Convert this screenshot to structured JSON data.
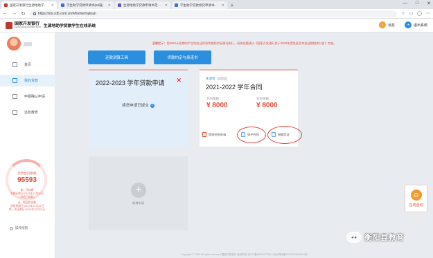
{
  "browser": {
    "tabs": [
      {
        "label": "国家开发银行生源地助学贷款学…",
        "icon": "red-square-icon",
        "active": true
      },
      {
        "label": "学生助学贷款申请书(50篇)",
        "icon": "blue-page-icon",
        "active": false
      },
      {
        "label": "生源地助学贷款申请书范文150字 -",
        "icon": "purple-page-icon",
        "active": false
      },
      {
        "label": "学生助学贷款续贷申请书（通用15",
        "icon": "blue-page-icon",
        "active": false
      }
    ],
    "new_tab": "+",
    "url": "https://sls.cdb.com.cn/#/home/myloan",
    "win_controls": [
      "—",
      "□",
      "✕"
    ]
  },
  "header": {
    "bank_name": "国家开发银行",
    "bank_name_en": "CHINA DEVELOPMENT BANK",
    "system_title": "生源地助学贷款学生在线系统",
    "message_label": "消息",
    "logout_label": "退出系统"
  },
  "sidebar": {
    "menu": [
      {
        "label": "首页",
        "icon": "home-icon",
        "active": false
      },
      {
        "label": "我的贷款",
        "icon": "loan-icon",
        "active": true
      },
      {
        "label": "申报确认申请",
        "icon": "confirm-icon",
        "active": false
      },
      {
        "label": "还款教育",
        "icon": "edit-icon",
        "active": false
      }
    ],
    "balance_label": "贷款合同余额",
    "balance_amount": "95593",
    "balance_lines": [
      "剩 - 还款期",
      "本期还款日:2023年12月20日",
      "(节假日顺延)",
      "还 - 期还款金额",
      "贷款到期日:2037年12月20日",
      "第一次还款日:2019年12月20日"
    ],
    "help_label": "操作指南"
  },
  "main": {
    "notice": "温馨提示：您2022计息期内产生的应还利息将按照实际情况执行，具体金额请以《国家开发银行关于2022年度免息及本金延期相关公告》为准。",
    "btn_calculator": "还款测算工具",
    "btn_contract": "贷款约定与承诺书",
    "apply_card": {
      "title": "2022-2023 学年贷款申请",
      "close": "✕",
      "status": "续贷申请已提交",
      "status_icon": "?"
    },
    "contract_card": {
      "tag": "生源地",
      "title": "2021-2022 学年合同",
      "contract_amount_label": "合同金额",
      "contract_amount": "¥ 8000",
      "disbursed_label": "合同金额",
      "disbursed_amount": "¥ 8000",
      "action_repay": "提前还款申请",
      "action_econtract": "电子合同",
      "action_receipt": "借据凭证"
    },
    "new_card": {
      "plus": "+",
      "label": "新增申请"
    }
  },
  "online_help": {
    "label": "在线咨询",
    "icon": "headset-icon"
  },
  "footer": "Copyright © 2009 All rights reserved 国家开发银行 版权所有 京ICP备05009172号-9  京公网安备11010202000001号",
  "watermark": {
    "text": "衡阳县教育"
  },
  "colors": {
    "accent": "#2b8fe0",
    "danger": "#e4483a",
    "brand": "#c0392b"
  }
}
